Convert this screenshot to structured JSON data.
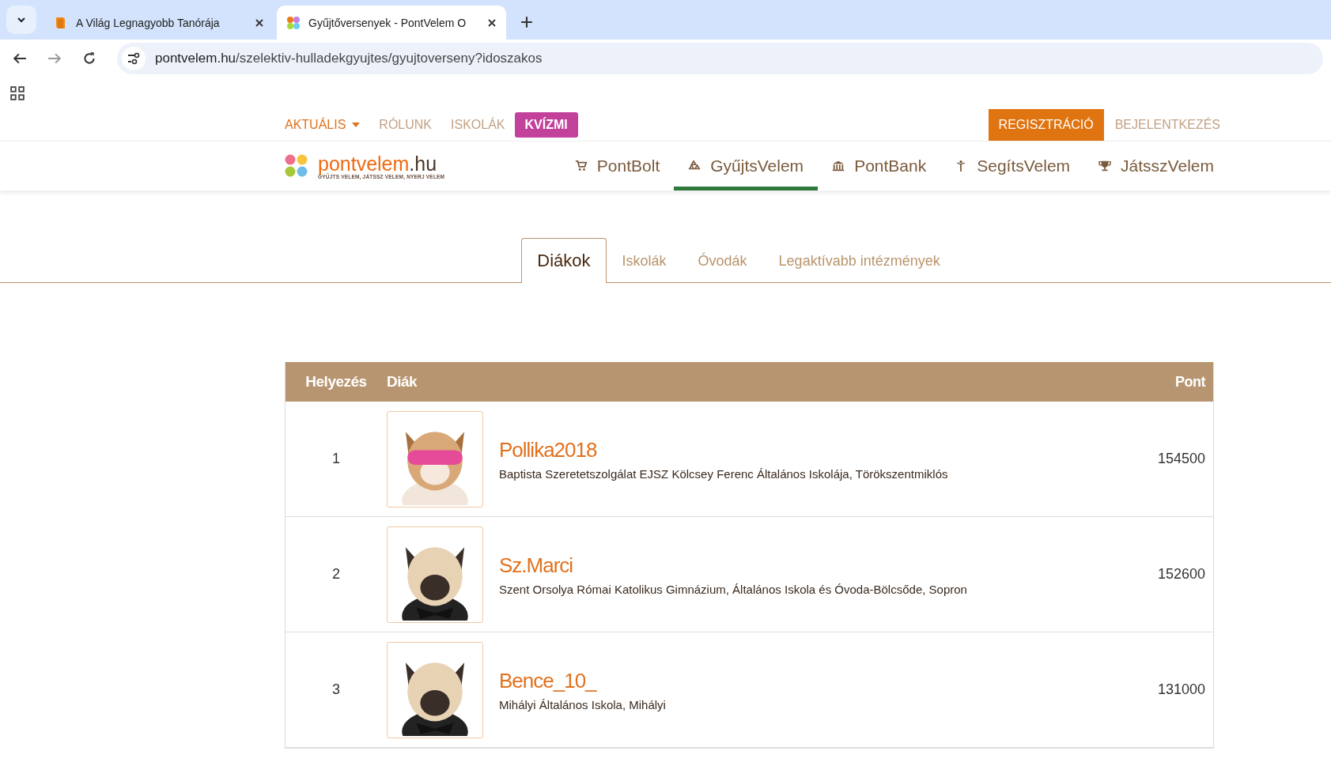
{
  "browser": {
    "tabs": [
      {
        "title": "A Világ Legnagyobb Tanórája",
        "selected": false
      },
      {
        "title": "Gyűjtőversenyek - PontVelem O",
        "selected": true
      }
    ],
    "url": {
      "host": "pontvelem.hu",
      "path": "/szelektiv-hulladekgyujtes/gyujtoverseny?idoszakos"
    }
  },
  "top_nav": [
    {
      "label": "AKTUÁLIS",
      "kind": "dropdown"
    },
    {
      "label": "RÓLUNK",
      "kind": "link"
    },
    {
      "label": "ISKOLÁK",
      "kind": "link"
    },
    {
      "label": "KVÍZMI",
      "kind": "highlight"
    }
  ],
  "auth": [
    {
      "label": "REGISZTRÁCIÓ",
      "kind": "primary"
    },
    {
      "label": "BEJELENTKEZÉS",
      "kind": "link"
    }
  ],
  "logo": {
    "name": "pontvelem",
    "suffix": ".hu",
    "tagline": "GYŰJTS VELEM, JÁTSSZ VELEM, NYERJ VELEM"
  },
  "main_nav": [
    {
      "label": "PontBolt",
      "selected": false
    },
    {
      "label": "GyűjtsVelem",
      "selected": true
    },
    {
      "label": "PontBank",
      "selected": false
    },
    {
      "label": "SegítsVelem",
      "selected": false
    },
    {
      "label": "JátsszVelem",
      "selected": false
    }
  ],
  "sub_tabs": [
    {
      "label": "Diákok",
      "selected": true
    },
    {
      "label": "Iskolák",
      "selected": false
    },
    {
      "label": "Óvodák",
      "selected": false
    },
    {
      "label": "Legaktívabb intézmények",
      "selected": false
    }
  ],
  "table": {
    "columns": [
      "Helyezés",
      "Diák",
      "Pont"
    ],
    "rows": [
      {
        "rank": "1",
        "name": "Pollika2018",
        "school": "Baptista Szeretetszolgálat EJSZ Kölcsey Ferenc Általános Iskolája, Törökszentmiklós",
        "points": "154500"
      },
      {
        "rank": "2",
        "name": "Sz.Marci",
        "school": "Szent Orsolya Római Katolikus Gimnázium, Általános Iskola és Óvoda-Bölcsőde, Sopron",
        "points": "152600"
      },
      {
        "rank": "3",
        "name": "Bence_10_",
        "school": "Mihályi Általános Iskola, Mihályi",
        "points": "131000"
      }
    ]
  }
}
